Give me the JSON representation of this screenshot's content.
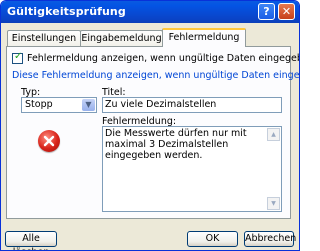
{
  "window": {
    "title": "Gültigkeitsprüfung",
    "help_label": "?",
    "close_label": "✕"
  },
  "tabs": [
    {
      "label": "Einstellungen",
      "active": false
    },
    {
      "label": "Eingabemeldung",
      "active": false
    },
    {
      "label": "Fehlermeldung",
      "active": true
    }
  ],
  "panel": {
    "show_error_checkbox": {
      "checked": true,
      "label": "Fehlermeldung anzeigen, wenn ungültige Daten eingegeben wurden."
    },
    "section_heading": "Diese Fehlermeldung anzeigen, wenn ungültige Daten eingegeben wurden:",
    "type_label": "Typ:",
    "type_value": "Stopp",
    "title_label": "Titel:",
    "title_value": "Zu viele Dezimalstellen",
    "message_label": "Fehlermeldung:",
    "message_value": "Die Messwerte dürfen nur mit maximal 3 Dezimalstellen eingegeben werden.",
    "icon": "error-stop-icon"
  },
  "buttons": {
    "clear_all": "Alle löschen",
    "ok": "OK",
    "cancel": "Abbrechen"
  }
}
